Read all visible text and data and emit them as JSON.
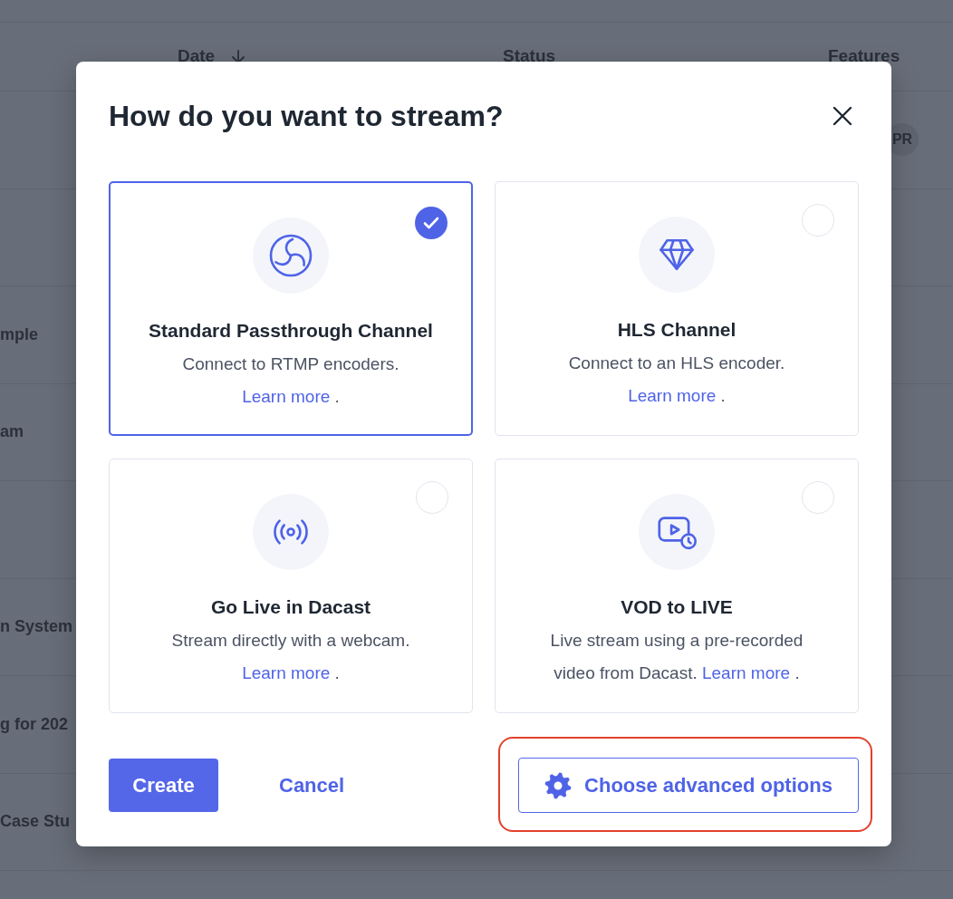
{
  "background_table": {
    "columns": [
      {
        "label": "Date",
        "sorted": true
      },
      {
        "label": "Status",
        "sorted": false
      },
      {
        "label": "Features",
        "sorted": false
      }
    ],
    "rows": [
      {
        "features_avatar": "PR"
      },
      {},
      {
        "column_1": "mple"
      },
      {
        "column_1": "am"
      },
      {},
      {
        "column_1": "n System"
      },
      {
        "column_1": "g for 202"
      },
      {
        "column_1": "Case Stu"
      },
      {}
    ]
  },
  "dialog": {
    "title": "How do you want to stream?",
    "options": [
      {
        "kind": "rtmp",
        "title": "Standard Passthrough Channel",
        "description": "Connect to RTMP encoders.",
        "link": "Learn more",
        "after_link": ".",
        "selected": true
      },
      {
        "kind": "hls",
        "title": "HLS Channel",
        "description": "Connect to an HLS encoder.",
        "link": "Learn more",
        "after_link": ".",
        "selected": false
      },
      {
        "kind": "webcam",
        "title": "Go Live in Dacast",
        "description": "Stream directly with a webcam.",
        "link": "Learn more",
        "after_link": ".",
        "selected": false
      },
      {
        "kind": "vod",
        "title": "VOD to LIVE",
        "description": "Live stream using a pre-recorded video from Dacast.",
        "link": "Learn more",
        "after_link": ".",
        "selected": false
      }
    ],
    "create_button": "Create",
    "cancel_button": "Cancel",
    "advanced_button": {
      "label": "Choose advanced options",
      "highlighted": true
    }
  }
}
